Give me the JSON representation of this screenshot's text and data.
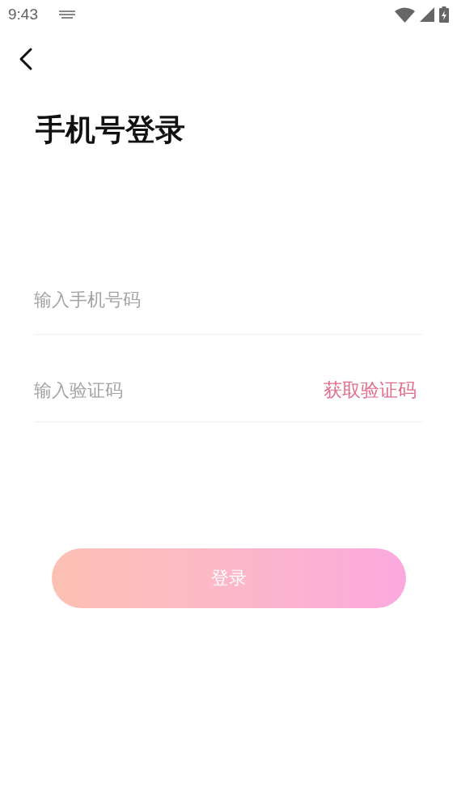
{
  "status_bar": {
    "time": "9:43"
  },
  "title": "手机号登录",
  "phone_field": {
    "placeholder": "输入手机号码"
  },
  "code_field": {
    "placeholder": "输入验证码"
  },
  "get_code_link": "获取验证码",
  "login_button": {
    "label": "登录",
    "disabled": true
  }
}
